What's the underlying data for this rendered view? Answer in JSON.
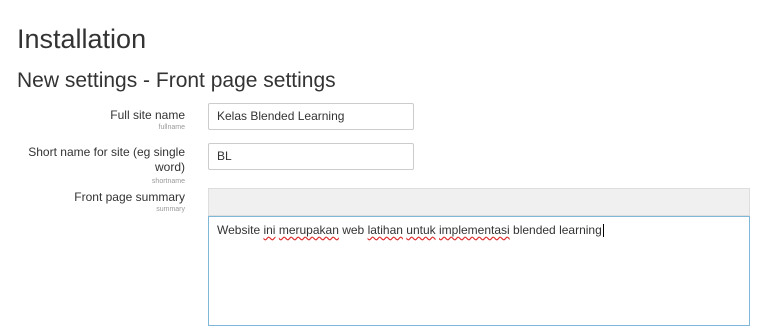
{
  "page": {
    "title": "Installation",
    "subtitle": "New settings - Front page settings"
  },
  "fields": {
    "fullname": {
      "label": "Full site name",
      "sublabel": "fullname",
      "value": "Kelas Blended Learning"
    },
    "shortname": {
      "label_line1": "Short name for site (eg single",
      "label_line2": "word)",
      "sublabel": "shortname",
      "value": "BL"
    },
    "summary": {
      "label": "Front page summary",
      "sublabel": "summary",
      "text_parts": [
        "Website ",
        "ini",
        " ",
        "merupakan",
        " web ",
        "latihan",
        " ",
        "untuk",
        " ",
        "implementasi",
        " blended learning"
      ]
    }
  }
}
